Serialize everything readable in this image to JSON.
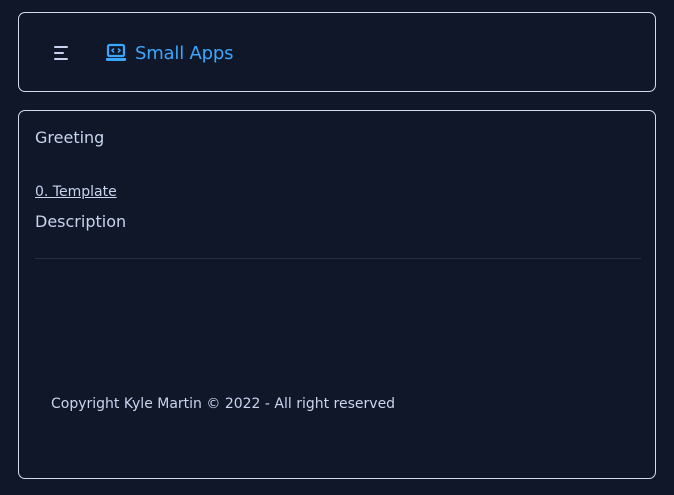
{
  "navbar": {
    "brand_label": "Small Apps",
    "brand_icon": "laptop-code-icon",
    "menu_icon": "menu-icon",
    "accent_color": "#3aa7ff"
  },
  "content": {
    "greeting": "Greeting",
    "template_link": "0. Template",
    "description": "Description"
  },
  "footer": {
    "copyright": "Copyright Kyle Martin © 2022 - All right reserved"
  },
  "colors": {
    "background": "#0f1729",
    "text": "#c9d4ef",
    "border": "#d5dbe6"
  }
}
